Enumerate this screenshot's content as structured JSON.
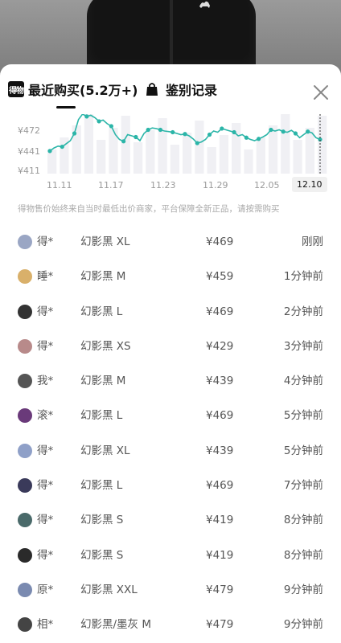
{
  "tabs": {
    "recent_badge": "得物",
    "recent_label": "最近购买(5.2万+)",
    "auth_label": "鉴别记录"
  },
  "chart_data": {
    "type": "line",
    "y_ticks": [
      "¥472",
      "¥441",
      "¥411"
    ],
    "x_ticks": [
      "11.11",
      "11.17",
      "11.23",
      "11.29",
      "12.05",
      "12.10"
    ],
    "current_tick": "12.10",
    "y_range": [
      411,
      472
    ],
    "series": [
      {
        "values": [
          443,
          448,
          451,
          450,
          455,
          460,
          472,
          495,
          504,
          500,
          502,
          498,
          492,
          494,
          488,
          484,
          470,
          462,
          459,
          470,
          468,
          466,
          460,
          472,
          478,
          481,
          480,
          478,
          476,
          475,
          474,
          472,
          470,
          471,
          468,
          463,
          456,
          458,
          462,
          470,
          476,
          474,
          480,
          478,
          476,
          474,
          468,
          470,
          465,
          462,
          460,
          463,
          466,
          470,
          478,
          476,
          478,
          475,
          474,
          477,
          472,
          465,
          470,
          475,
          473,
          465,
          462
        ]
      }
    ]
  },
  "disclaimer": "得物售价始终来自当时最低出价商家，平台保障全新正品，请按需购买",
  "purchases": [
    {
      "user": "得*",
      "product": "幻影黑 XL",
      "price": "¥469",
      "time": "刚刚",
      "avatar_color": "#9aa6c4"
    },
    {
      "user": "睡*",
      "product": "幻影黑 M",
      "price": "¥459",
      "time": "1分钟前",
      "avatar_color": "#d9b06a"
    },
    {
      "user": "得*",
      "product": "幻影黑 L",
      "price": "¥469",
      "time": "2分钟前",
      "avatar_color": "#333333"
    },
    {
      "user": "得*",
      "product": "幻影黑 XS",
      "price": "¥429",
      "time": "3分钟前",
      "avatar_color": "#b88a8a"
    },
    {
      "user": "我*",
      "product": "幻影黑 M",
      "price": "¥439",
      "time": "4分钟前",
      "avatar_color": "#555555"
    },
    {
      "user": "滚*",
      "product": "幻影黑 L",
      "price": "¥469",
      "time": "5分钟前",
      "avatar_color": "#6a3a7a"
    },
    {
      "user": "得*",
      "product": "幻影黑 XL",
      "price": "¥439",
      "time": "5分钟前",
      "avatar_color": "#8fa0c8"
    },
    {
      "user": "得*",
      "product": "幻影黑 L",
      "price": "¥469",
      "time": "7分钟前",
      "avatar_color": "#3a3a5a"
    },
    {
      "user": "得*",
      "product": "幻影黑 S",
      "price": "¥419",
      "time": "8分钟前",
      "avatar_color": "#4a6a6a"
    },
    {
      "user": "得*",
      "product": "幻影黑 S",
      "price": "¥419",
      "time": "8分钟前",
      "avatar_color": "#2a2a2a"
    },
    {
      "user": "原*",
      "product": "幻影黑 XXL",
      "price": "¥479",
      "time": "9分钟前",
      "avatar_color": "#7a8ab0"
    },
    {
      "user": "相*",
      "product": "幻影黑/墨灰 M",
      "price": "¥479",
      "time": "9分钟前",
      "avatar_color": "#444444"
    }
  ],
  "colors": {
    "line": "#2bb5a8",
    "bars": "#f0f0f4"
  }
}
